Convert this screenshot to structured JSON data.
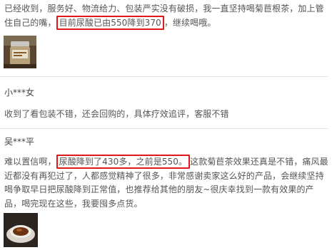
{
  "reviews": [
    {
      "user": "",
      "text_before": "已经收到，服务好、物流给力、包装严实没有破损，我一直坚持喝菊苣根茶，加上管住自己的嘴，",
      "highlight": "目前尿酸已由550降到370",
      "text_after": "，继续喝哦。",
      "has_image": true,
      "image_label": "jar-of-tea"
    },
    {
      "user": "小***女",
      "text_before": "收到了看包装不错，还会回购的，具体疗效追评，客服不错",
      "highlight": "",
      "text_after": "",
      "has_image": false
    },
    {
      "user": "吴***平",
      "text_before": "难以置信啊，",
      "highlight": "尿酸降到了430多，之前是550。",
      "text_after": "这款菊苣茶效果还真是不错，痛风最近都没有再犯过了，人都感觉精神了很多，非常感谢卖家这么好的产品，会继续坚持喝争取早日把尿酸降到正常值，也推荐给其他的朋友~很庆幸找到一款有效果的产品，喝完现在这些，我要囤多点货。",
      "has_image": true,
      "image_label": "cup-of-tea"
    }
  ]
}
